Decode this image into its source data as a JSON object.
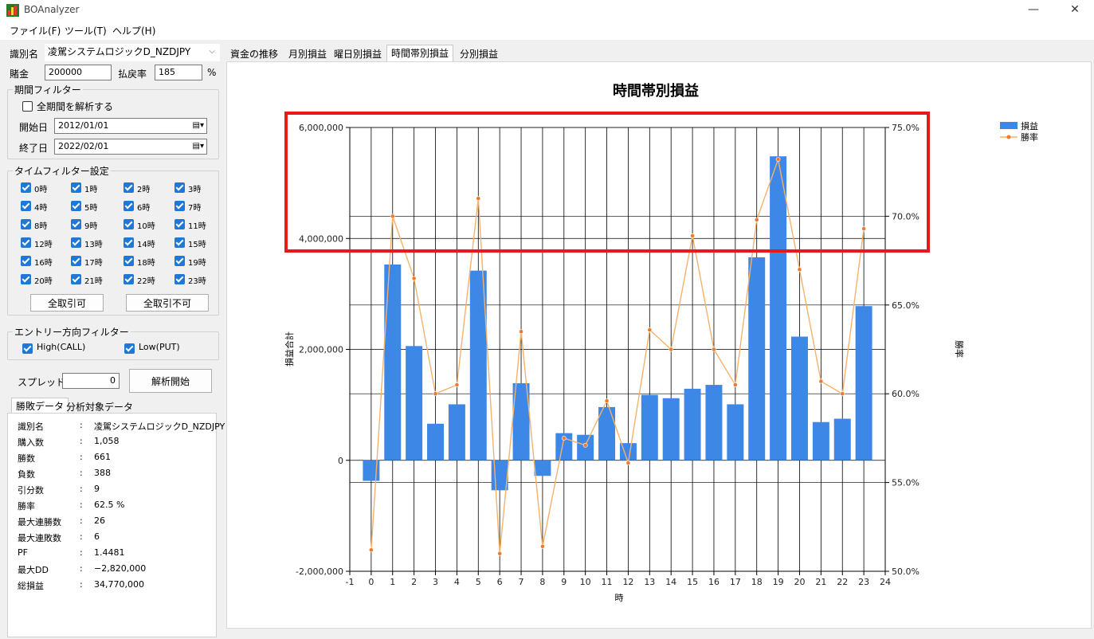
{
  "window": {
    "title": "BOAnalyzer",
    "min": "—",
    "max": "☐",
    "close": "✕"
  },
  "menu": [
    "ファイル(F)",
    "ツール(T)",
    "ヘルプ(H)"
  ],
  "settings": {
    "id_label": "識別名",
    "id_value": "凌駕システムロジックD_NZDJPY",
    "stake_label": "賭金",
    "stake_value": "200000",
    "payout_label": "払戻率",
    "payout_value": "185",
    "payout_unit": "%"
  },
  "period_filter": {
    "title": "期間フィルター",
    "all_period_label": "全期間を解析する",
    "start_label": "開始日",
    "start_value": "2012/01/01",
    "end_label": "終了日",
    "end_value": "2022/02/01"
  },
  "time_filter": {
    "title": "タイムフィルター設定",
    "hours": [
      "0時",
      "1時",
      "2時",
      "3時",
      "4時",
      "5時",
      "6時",
      "7時",
      "8時",
      "9時",
      "10時",
      "11時",
      "12時",
      "13時",
      "14時",
      "15時",
      "16時",
      "17時",
      "18時",
      "19時",
      "20時",
      "21時",
      "22時",
      "23時"
    ],
    "select_all": "全取引可",
    "deselect_all": "全取引不可"
  },
  "entry_filter": {
    "title": "エントリー方向フィルター",
    "high": "High(CALL)",
    "low": "Low(PUT)"
  },
  "spread": {
    "label": "スプレッド",
    "value": "0",
    "analyze_button": "解析開始"
  },
  "stats_tabs": [
    "勝敗データ",
    "分析対象データ"
  ],
  "stats": [
    {
      "key": "識別名",
      "value": "凌駕システムロジックD_NZDJPY"
    },
    {
      "key": "購入数",
      "value": "1,058"
    },
    {
      "key": "勝数",
      "value": "661"
    },
    {
      "key": "負数",
      "value": "388"
    },
    {
      "key": "引分数",
      "value": "9"
    },
    {
      "key": "勝率",
      "value": "62.5 %"
    },
    {
      "key": "最大連勝数",
      "value": "26"
    },
    {
      "key": "最大連敗数",
      "value": "6"
    },
    {
      "key": "PF",
      "value": "1.4481"
    },
    {
      "key": "最大DD",
      "value": "−2,820,000"
    },
    {
      "key": "総損益",
      "value": "34,770,000"
    }
  ],
  "stat_sep": ":",
  "chart_tabs": [
    "資金の推移",
    "月別損益",
    "曜日別損益",
    "時間帯別損益",
    "分別損益"
  ],
  "colors": {
    "bar": "#3d87e6",
    "line": "#f6b26b",
    "marker": "#f07a2a",
    "highlight": "#e8191b",
    "win_blue": "#1e78d7"
  },
  "chart_data": {
    "type": "bar",
    "title": "時間帯別損益",
    "xlabel": "時",
    "ylabel": "損益合計",
    "y2label": "勝率",
    "legend": [
      "損益",
      "勝率"
    ],
    "legend_position": "top-right",
    "x": [
      0,
      1,
      2,
      3,
      4,
      5,
      6,
      7,
      8,
      9,
      10,
      11,
      12,
      13,
      14,
      15,
      16,
      17,
      18,
      19,
      20,
      21,
      22,
      23
    ],
    "x_ticks": [
      "-1",
      "0",
      "1",
      "2",
      "3",
      "4",
      "5",
      "6",
      "7",
      "8",
      "9",
      "10",
      "11",
      "12",
      "13",
      "14",
      "15",
      "16",
      "17",
      "18",
      "19",
      "20",
      "21",
      "22",
      "23",
      "24"
    ],
    "xlim": [
      -1,
      24
    ],
    "ylim": [
      -2000000,
      6000000
    ],
    "y_ticks": [
      "-2,000,000",
      "0",
      "2,000,000",
      "4,000,000",
      "6,000,000"
    ],
    "y2lim": [
      50,
      75
    ],
    "y2_ticks": [
      "50.0%",
      "55.0%",
      "60.0%",
      "65.0%",
      "70.0%",
      "75.0%"
    ],
    "grid": true,
    "series": [
      {
        "name": "損益",
        "type": "bar",
        "values": [
          -370000,
          3530000,
          2060000,
          660000,
          1010000,
          3420000,
          -540000,
          1390000,
          -280000,
          490000,
          460000,
          960000,
          310000,
          1180000,
          1120000,
          1290000,
          1360000,
          1010000,
          3660000,
          5480000,
          2230000,
          690000,
          750000,
          2780000
        ]
      },
      {
        "name": "勝率",
        "type": "line",
        "values": [
          51.2,
          70.0,
          66.5,
          60.0,
          60.5,
          71.0,
          51.0,
          63.5,
          51.4,
          57.5,
          57.1,
          59.6,
          56.1,
          63.6,
          62.5,
          68.9,
          62.5,
          60.5,
          69.8,
          73.2,
          67.0,
          60.7,
          60.0,
          69.3
        ]
      }
    ]
  }
}
